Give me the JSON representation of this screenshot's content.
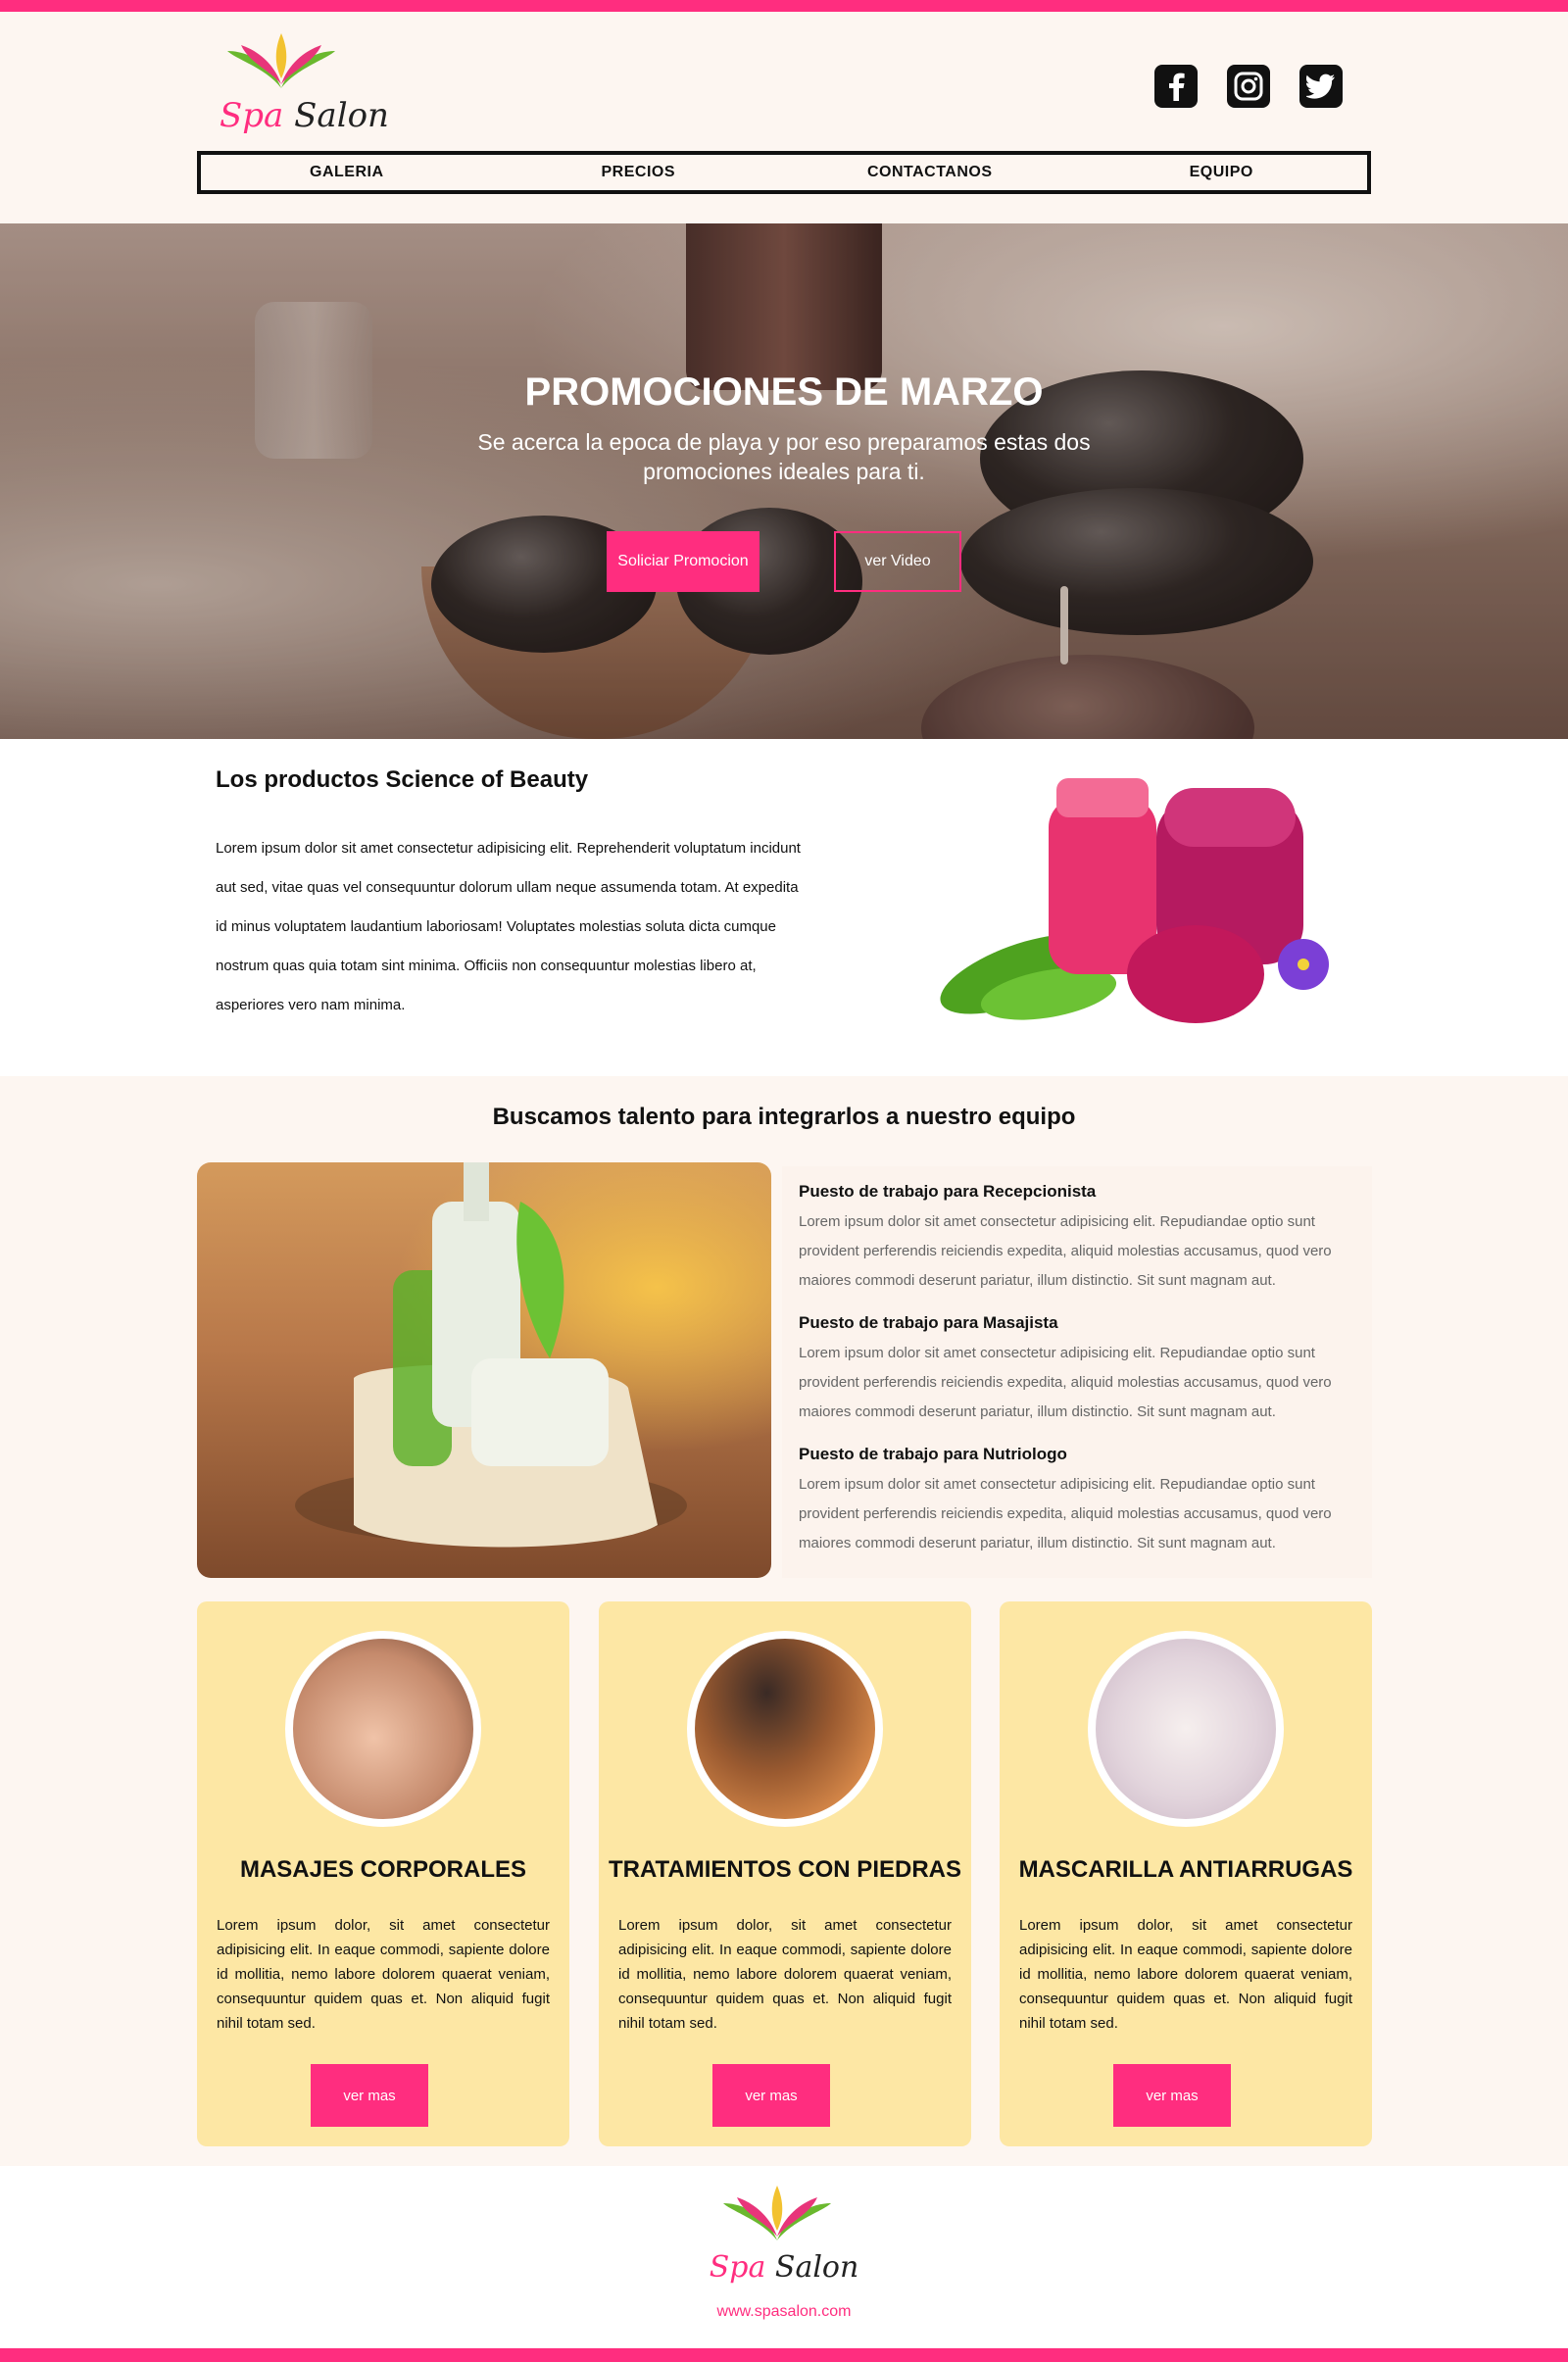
{
  "brand": {
    "name_part1": "Spa",
    "name_part2": "Salon",
    "accent": "#ff2d7f"
  },
  "social": [
    {
      "icon": "facebook-icon"
    },
    {
      "icon": "instagram-icon"
    },
    {
      "icon": "twitter-icon"
    }
  ],
  "nav": {
    "items": [
      {
        "label": "GALERIA"
      },
      {
        "label": "PRECIOS"
      },
      {
        "label": "CONTACTANOS"
      },
      {
        "label": "EQUIPO"
      }
    ]
  },
  "hero": {
    "title": "PROMOCIONES DE MARZO",
    "subtitle": "Se acerca la epoca de playa y por eso preparamos estas dos promociones ideales para ti.",
    "primary_button": "Soliciar Promocion",
    "secondary_button": "ver Video"
  },
  "products": {
    "title": "Los productos Science of Beauty",
    "body": "Lorem ipsum dolor sit amet consectetur adipisicing elit. Reprehenderit voluptatum incidunt aut sed, vitae quas vel consequuntur dolorum ullam neque assumenda totam. At expedita id minus voluptatem laudantium laboriosam! Voluptates molestias soluta dicta cumque nostrum quas quia totam sint minima. Officiis non consequuntur molestias libero at, asperiores vero nam minima."
  },
  "talent": {
    "title": "Buscamos talento para integrarlos a nuestro equipo",
    "jobs": [
      {
        "title": "Puesto de trabajo para Recepcionista",
        "desc": "Lorem ipsum dolor sit amet consectetur adipisicing elit. Repudiandae optio sunt provident perferendis reiciendis expedita, aliquid molestias accusamus, quod vero maiores commodi deserunt pariatur, illum distinctio. Sit sunt magnam aut."
      },
      {
        "title": "Puesto de trabajo para Masajista",
        "desc": "Lorem ipsum dolor sit amet consectetur adipisicing elit. Repudiandae optio sunt provident perferendis reiciendis expedita, aliquid molestias accusamus, quod vero maiores commodi deserunt pariatur, illum distinctio. Sit sunt magnam aut."
      },
      {
        "title": "Puesto de trabajo para Nutriologo",
        "desc": "Lorem ipsum dolor sit amet consectetur adipisicing elit. Repudiandae optio sunt provident perferendis reiciendis expedita, aliquid molestias accusamus, quod vero maiores commodi deserunt pariatur, illum distinctio. Sit sunt magnam aut."
      }
    ]
  },
  "services": [
    {
      "title": "MASAJES CORPORALES",
      "desc": "Lorem ipsum dolor, sit amet consectetur adipisicing elit. In eaque commodi, sapiente dolore id mollitia, nemo labore dolorem quaerat veniam, consequuntur quidem quas et. Non aliquid fugit nihil totam sed.",
      "button": "ver mas"
    },
    {
      "title": "TRATAMIENTOS CON PIEDRAS",
      "desc": "Lorem ipsum dolor, sit amet consectetur adipisicing elit. In eaque commodi, sapiente dolore id mollitia, nemo labore dolorem quaerat veniam, consequuntur quidem quas et. Non aliquid fugit nihil totam sed.",
      "button": "ver mas"
    },
    {
      "title": "MASCARILLA ANTIARRUGAS",
      "desc": "Lorem ipsum dolor, sit amet consectetur adipisicing elit. In eaque commodi, sapiente dolore id mollitia, nemo labore dolorem quaerat veniam, consequuntur quidem quas et. Non aliquid fugit nihil totam sed.",
      "button": "ver mas"
    }
  ],
  "footer": {
    "url": "www.spasalon.com"
  }
}
